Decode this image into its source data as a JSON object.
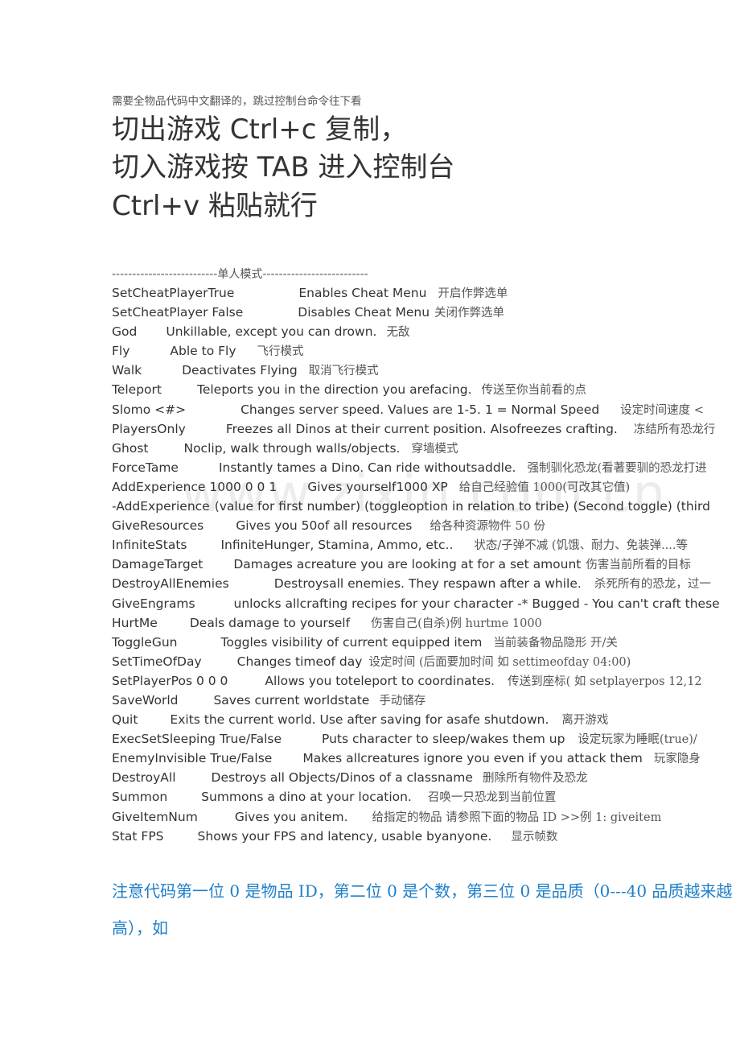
{
  "intro_note": "需要全物品代码中文翻译的，跳过控制台命令往下看",
  "headlines": [
    "切出游戏 Ctrl+c 复制，",
    "切入游戏按 TAB  进入控制台",
    "Ctrl+v 粘贴就行"
  ],
  "section_divider": "--------------------------单人模式--------------------------",
  "commands": [
    {
      "cmd": "SetCheatPlayerTrue",
      "desc": "Enables Cheat Menu",
      "zh": "开启作弊选单"
    },
    {
      "cmd": "SetCheatPlayer False",
      "desc": "Disables Cheat Menu",
      "zh": "关闭作弊选单"
    },
    {
      "cmd": "God",
      "desc": "Unkillable, except you can drown.",
      "zh": "无敌"
    },
    {
      "cmd": "Fly",
      "desc": "Able to Fly",
      "zh": "飞行模式"
    },
    {
      "cmd": "Walk",
      "desc": "Deactivates Flying",
      "zh": "取消飞行模式"
    },
    {
      "cmd": "Teleport",
      "desc": "Teleports you in the direction you arefacing.",
      "zh": "传送至你当前看的点"
    },
    {
      "cmd": "Slomo <#>",
      "desc": "Changes server speed. Values are 1-5. 1 = Normal Speed",
      "zh": "设定时间速度 <"
    },
    {
      "cmd": "PlayersOnly",
      "desc": "Freezes all Dinos at their current position. Alsofreezes crafting.",
      "zh": "冻结所有恐龙行"
    },
    {
      "cmd": "Ghost",
      "desc": "Noclip, walk through walls/objects.",
      "zh": "穿墙模式"
    },
    {
      "cmd": "ForceTame",
      "desc": "Instantly tames a Dino. Can ride withoutsaddle.",
      "zh": "强制驯化恐龙(看著要驯的恐龙打进"
    },
    {
      "cmd": "AddExperience 1000 0 0 1",
      "desc": "Gives yourself1000 XP",
      "zh": "给自己经验值 1000(可改其它值)"
    },
    {
      "cmd": "-AddExperience",
      "desc": "(value for first number) (toggleoption in relation to tribe) (Second toggle) (third",
      "zh": ""
    },
    {
      "cmd": "GiveResources",
      "desc": "Gives you 50of all resources",
      "zh": "给各种资源物件 50 份"
    },
    {
      "cmd": "InfiniteStats",
      "desc": "InfiniteHunger, Stamina, Ammo, etc..",
      "zh": "状态/子弹不减 (饥饿、耐力、免装弹....等"
    },
    {
      "cmd": "DamageTarget",
      "desc": "Damages acreature you are looking at for a set amount",
      "zh": "伤害当前所看的目标"
    },
    {
      "cmd": "DestroyAllEnemies",
      "desc": "Destroysall enemies. They respawn after a while.",
      "zh": "杀死所有的恐龙，过一"
    },
    {
      "cmd": "GiveEngrams",
      "desc": "unlocks allcrafting recipes for your character -* Bugged - You can't craft these",
      "zh": ""
    },
    {
      "cmd": "HurtMe",
      "desc": "Deals damage to yourself",
      "zh": "伤害自己(自杀)例 hurtme 1000"
    },
    {
      "cmd": "ToggleGun",
      "desc": "Toggles visibility of current equipped item",
      "zh": "当前装备物品隐形 开/关"
    },
    {
      "cmd": "SetTimeOfDay",
      "desc": "Changes timeof day",
      "zh": "设定时间 (后面要加时间 如 settimeofday 04:00)"
    },
    {
      "cmd": "SetPlayerPos 0 0 0",
      "desc": "Allows you toteleport to coordinates.",
      "zh": "传送到座标( 如 setplayerpos 12,12"
    },
    {
      "cmd": "SaveWorld",
      "desc": "Saves current worldstate",
      "zh": "手动储存"
    },
    {
      "cmd": "Quit",
      "desc": "Exits the current world. Use after saving for asafe shutdown.",
      "zh": "离开游戏"
    },
    {
      "cmd": "ExecSetSleeping True/False",
      "desc": "Puts character to sleep/wakes them up",
      "zh": "设定玩家为睡眠(true)/"
    },
    {
      "cmd": "EnemyInvisible True/False",
      "desc": "Makes allcreatures ignore you even if you attack them",
      "zh": "玩家隐身"
    },
    {
      "cmd": "DestroyAll",
      "desc": "Destroys all Objects/Dinos of a classname",
      "zh": "删除所有物件及恐龙"
    },
    {
      "cmd": "Summon",
      "desc": "Summons a dino at your location.",
      "zh": "召唤一只恐龙到当前位置"
    },
    {
      "cmd": "GiveItemNum",
      "desc": "Gives you anitem.",
      "zh": "给指定的物品      请参照下面的物品 ID    >>例 1:   giveitem"
    },
    {
      "cmd": "Stat FPS",
      "desc": "Shows your FPS and latency, usable byanyone.",
      "zh": "显示帧数"
    }
  ],
  "blue_note": "注意代码第一位 0 是物品 ID，第二位 0 是个数，第三位 0 是品质（0---40 品质越来越高），如",
  "watermark": "www.zixin.com.cn",
  "colors": {
    "text": "#333333",
    "note_blue": "#1e7fc9"
  }
}
